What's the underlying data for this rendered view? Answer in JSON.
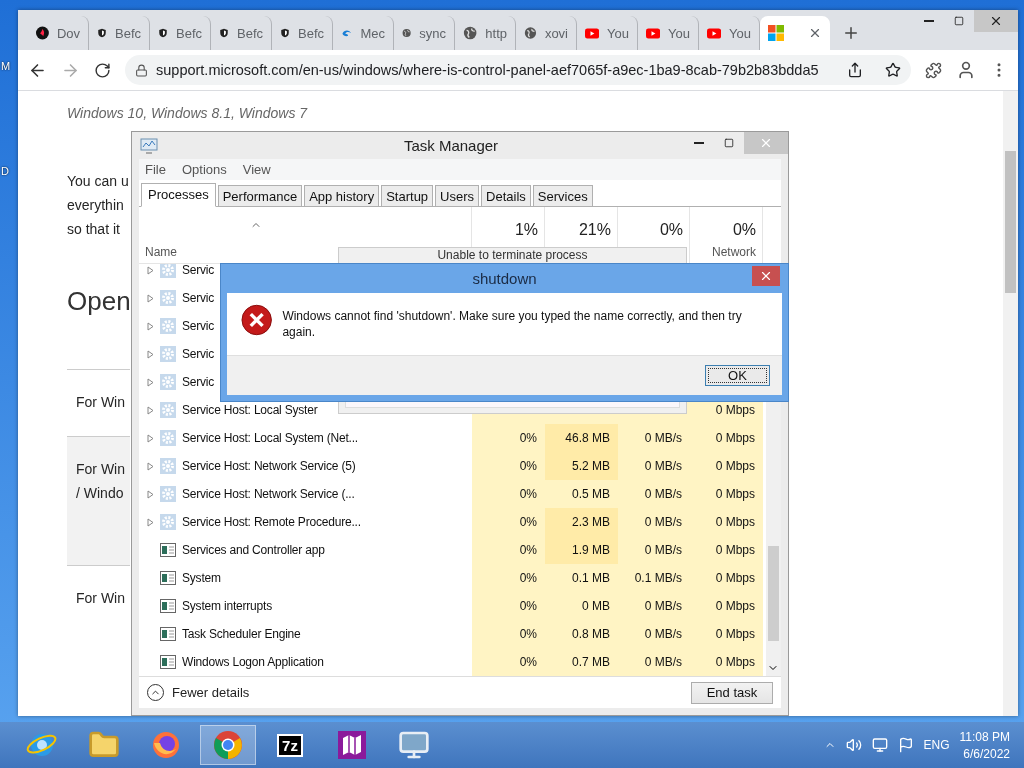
{
  "desktop": {
    "labels": [
      "M",
      "D"
    ]
  },
  "browser": {
    "tabs": [
      {
        "kind": "flame",
        "title": "Dov",
        "selected": false
      },
      {
        "kind": "shield",
        "title": "Befc",
        "selected": false
      },
      {
        "kind": "shield",
        "title": "Befc",
        "selected": false
      },
      {
        "kind": "shield",
        "title": "Befc",
        "selected": false
      },
      {
        "kind": "shield",
        "title": "Befc",
        "selected": false
      },
      {
        "kind": "swirl",
        "title": "Mec",
        "selected": false
      },
      {
        "kind": "globe",
        "title": "sync",
        "selected": false
      },
      {
        "kind": "globe",
        "title": "http",
        "selected": false
      },
      {
        "kind": "globe",
        "title": "xovi",
        "selected": false
      },
      {
        "kind": "video",
        "title": "You",
        "selected": false
      },
      {
        "kind": "video",
        "title": "You",
        "selected": false
      },
      {
        "kind": "video",
        "title": "You",
        "selected": false
      },
      {
        "kind": "squares",
        "selected": true
      }
    ],
    "url": "support.microsoft.com/en-us/windows/where-is-control-panel-aef7065f-a9ec-1ba9-8cab-79b2b83bdda5",
    "page": {
      "applies_to": "Windows 10, Windows 8.1, Windows 7",
      "intro_lines": [
        "You can u",
        "everythin",
        "so that it"
      ],
      "heading": "Open",
      "sections": [
        {
          "lines": [
            "For Win"
          ],
          "highlighted": false
        },
        {
          "lines": [
            "For Win",
            "/ Windo"
          ],
          "highlighted": true
        },
        {
          "lines": [
            "For Win"
          ],
          "highlighted": false
        }
      ]
    }
  },
  "task_manager": {
    "title": "Task Manager",
    "menu": [
      "File",
      "Options",
      "View"
    ],
    "tabs": [
      {
        "label": "Processes",
        "selected": true
      },
      {
        "label": "Performance",
        "selected": false
      },
      {
        "label": "App history",
        "selected": false
      },
      {
        "label": "Startup",
        "selected": false
      },
      {
        "label": "Users",
        "selected": false
      },
      {
        "label": "Details",
        "selected": false
      },
      {
        "label": "Services",
        "selected": false
      }
    ],
    "columns": {
      "name": "Name",
      "cpu": "1%",
      "memory": "21%",
      "disk": "0%",
      "network": "0%",
      "network_label": "Network"
    },
    "rows": [
      {
        "kind": "service",
        "name": "Servic"
      },
      {
        "kind": "service",
        "name": "Servic"
      },
      {
        "kind": "service",
        "name": "Servic"
      },
      {
        "kind": "service",
        "name": "Servic"
      },
      {
        "kind": "service",
        "name": "Servic"
      },
      {
        "kind": "service",
        "name": "Service Host: Local Syster",
        "network": "0 Mbps"
      },
      {
        "kind": "service",
        "name": "Service Host: Local System (Net...",
        "cpu": "0%",
        "memory": "46.8 MB",
        "disk": "0 MB/s",
        "network": "0 Mbps"
      },
      {
        "kind": "service",
        "name": "Service Host: Network Service (5)",
        "cpu": "0%",
        "memory": "5.2 MB",
        "disk": "0 MB/s",
        "network": "0 Mbps"
      },
      {
        "kind": "service",
        "name": "Service Host: Network Service (...",
        "cpu": "0%",
        "memory": "0.5 MB",
        "disk": "0 MB/s",
        "network": "0 Mbps"
      },
      {
        "kind": "service",
        "name": "Service Host: Remote Procedure...",
        "cpu": "0%",
        "memory": "2.3 MB",
        "disk": "0 MB/s",
        "network": "0 Mbps"
      },
      {
        "kind": "app",
        "name": "Services and Controller app",
        "cpu": "0%",
        "memory": "1.9 MB",
        "disk": "0 MB/s",
        "network": "0 Mbps"
      },
      {
        "kind": "app",
        "name": "System",
        "cpu": "0%",
        "memory": "0.1 MB",
        "disk": "0.1 MB/s",
        "network": "0 Mbps"
      },
      {
        "kind": "app",
        "name": "System interrupts",
        "cpu": "0%",
        "memory": "0 MB",
        "disk": "0 MB/s",
        "network": "0 Mbps"
      },
      {
        "kind": "app",
        "name": "Task Scheduler Engine",
        "cpu": "0%",
        "memory": "0.8 MB",
        "disk": "0 MB/s",
        "network": "0 Mbps"
      },
      {
        "kind": "app",
        "name": "Windows Logon Application",
        "cpu": "0%",
        "memory": "0.7 MB",
        "disk": "0 MB/s",
        "network": "0 Mbps"
      }
    ],
    "footer": {
      "toggle": "Fewer details",
      "button": "End task"
    }
  },
  "blocked_dialog": {
    "title": "Unable to terminate process"
  },
  "error_dialog": {
    "title": "shutdown",
    "message": "Windows cannot find 'shutdown'. Make sure you typed the name correctly, and then try again.",
    "button": "OK"
  },
  "taskbar": {
    "apps": [
      {
        "kind": "ie",
        "active": false
      },
      {
        "kind": "folder",
        "active": false
      },
      {
        "kind": "firefox",
        "active": false
      },
      {
        "kind": "chrome",
        "active": true
      },
      {
        "kind": "archiver",
        "label": "7z",
        "active": false
      },
      {
        "kind": "book",
        "active": false
      },
      {
        "kind": "monitor",
        "active": false
      }
    ],
    "tray": {
      "language": "ENG",
      "time": "11:08 PM",
      "date": "6/6/2022"
    }
  }
}
